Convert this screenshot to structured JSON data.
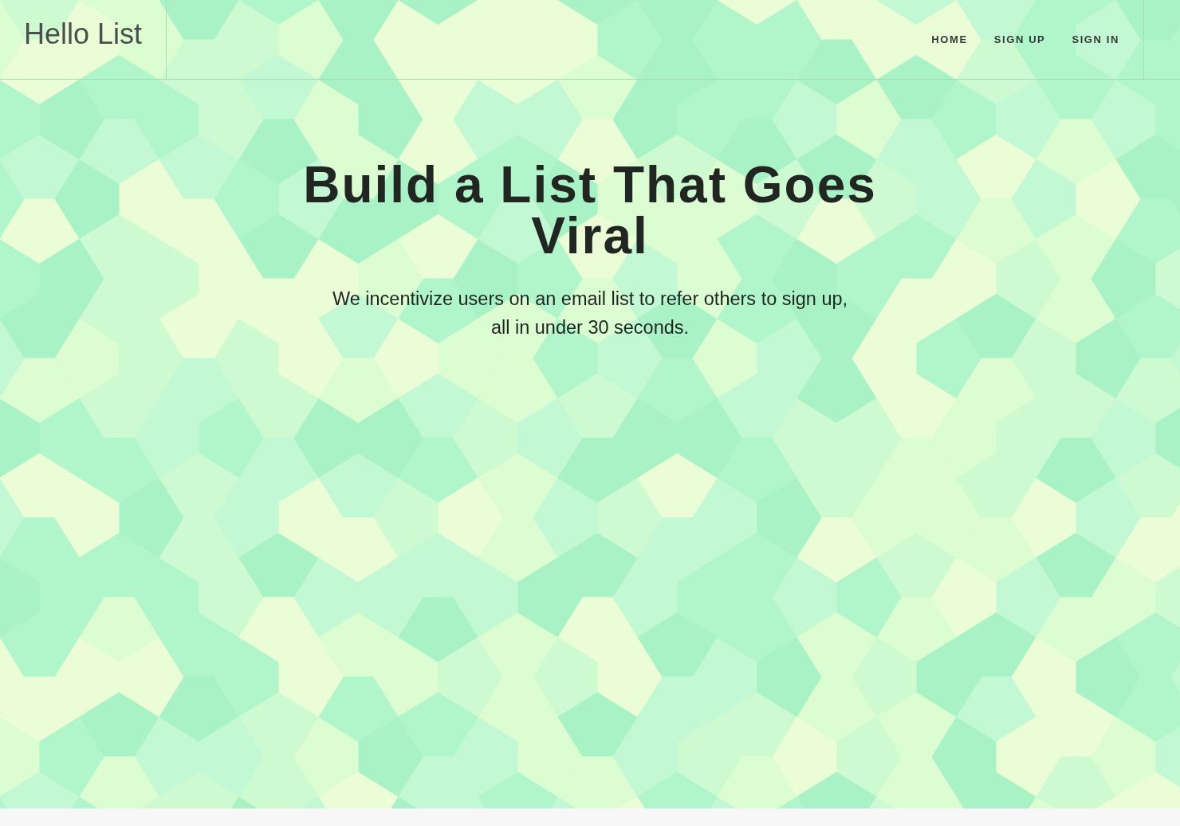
{
  "header": {
    "logo": "Hello List",
    "nav": [
      {
        "label": "HOME"
      },
      {
        "label": "SIGN UP"
      },
      {
        "label": "SIGN IN"
      }
    ]
  },
  "hero": {
    "title": "Build a List That Goes Viral",
    "subtitle": "We incentivize users on an email list to refer others to sign up, all in under 30 seconds."
  }
}
